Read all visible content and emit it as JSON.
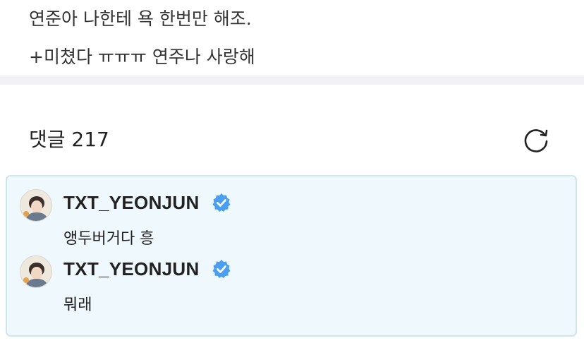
{
  "post": {
    "lines": [
      "연준아 나한테 욕 한번만 해조.",
      "+미쳤다 ㅠㅠㅠ 연주나 사랑해"
    ]
  },
  "comments_header": {
    "label": "댓글 217"
  },
  "icons": {
    "refresh": "refresh-icon",
    "verified": "verified-badge-icon",
    "accent_color": "#4a9ff0"
  },
  "thread": {
    "items": [
      {
        "author": "TXT_YEONJUN",
        "text": "앵두버거다 흥"
      },
      {
        "author": "TXT_YEONJUN",
        "text": "뭐래"
      }
    ]
  }
}
